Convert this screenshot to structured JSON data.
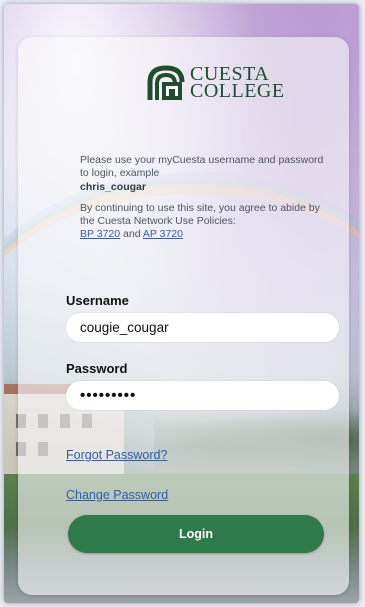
{
  "brand": {
    "logo_line1": "CUESTA",
    "logo_line2": "COLLEGE",
    "color": "#1f4d2e"
  },
  "info": {
    "intro": "Please use your myCuesta username and password to login, example",
    "example_user": "chris_cougar",
    "agree_text": "By continuing to use this site, you agree to abide by the Cuesta Network Use Policies:",
    "policy_link_1": "BP 3720",
    "and_text": " and ",
    "policy_link_2": "AP 3720"
  },
  "form": {
    "username_label": "Username",
    "username_value": "cougie_cougar",
    "password_label": "Password",
    "password_value": "•••••••••",
    "forgot_link": "Forgot Password?",
    "change_link": "Change Password",
    "login_label": "Login"
  },
  "colors": {
    "accent": "#2f7a4a",
    "link": "#2b5fb3"
  }
}
